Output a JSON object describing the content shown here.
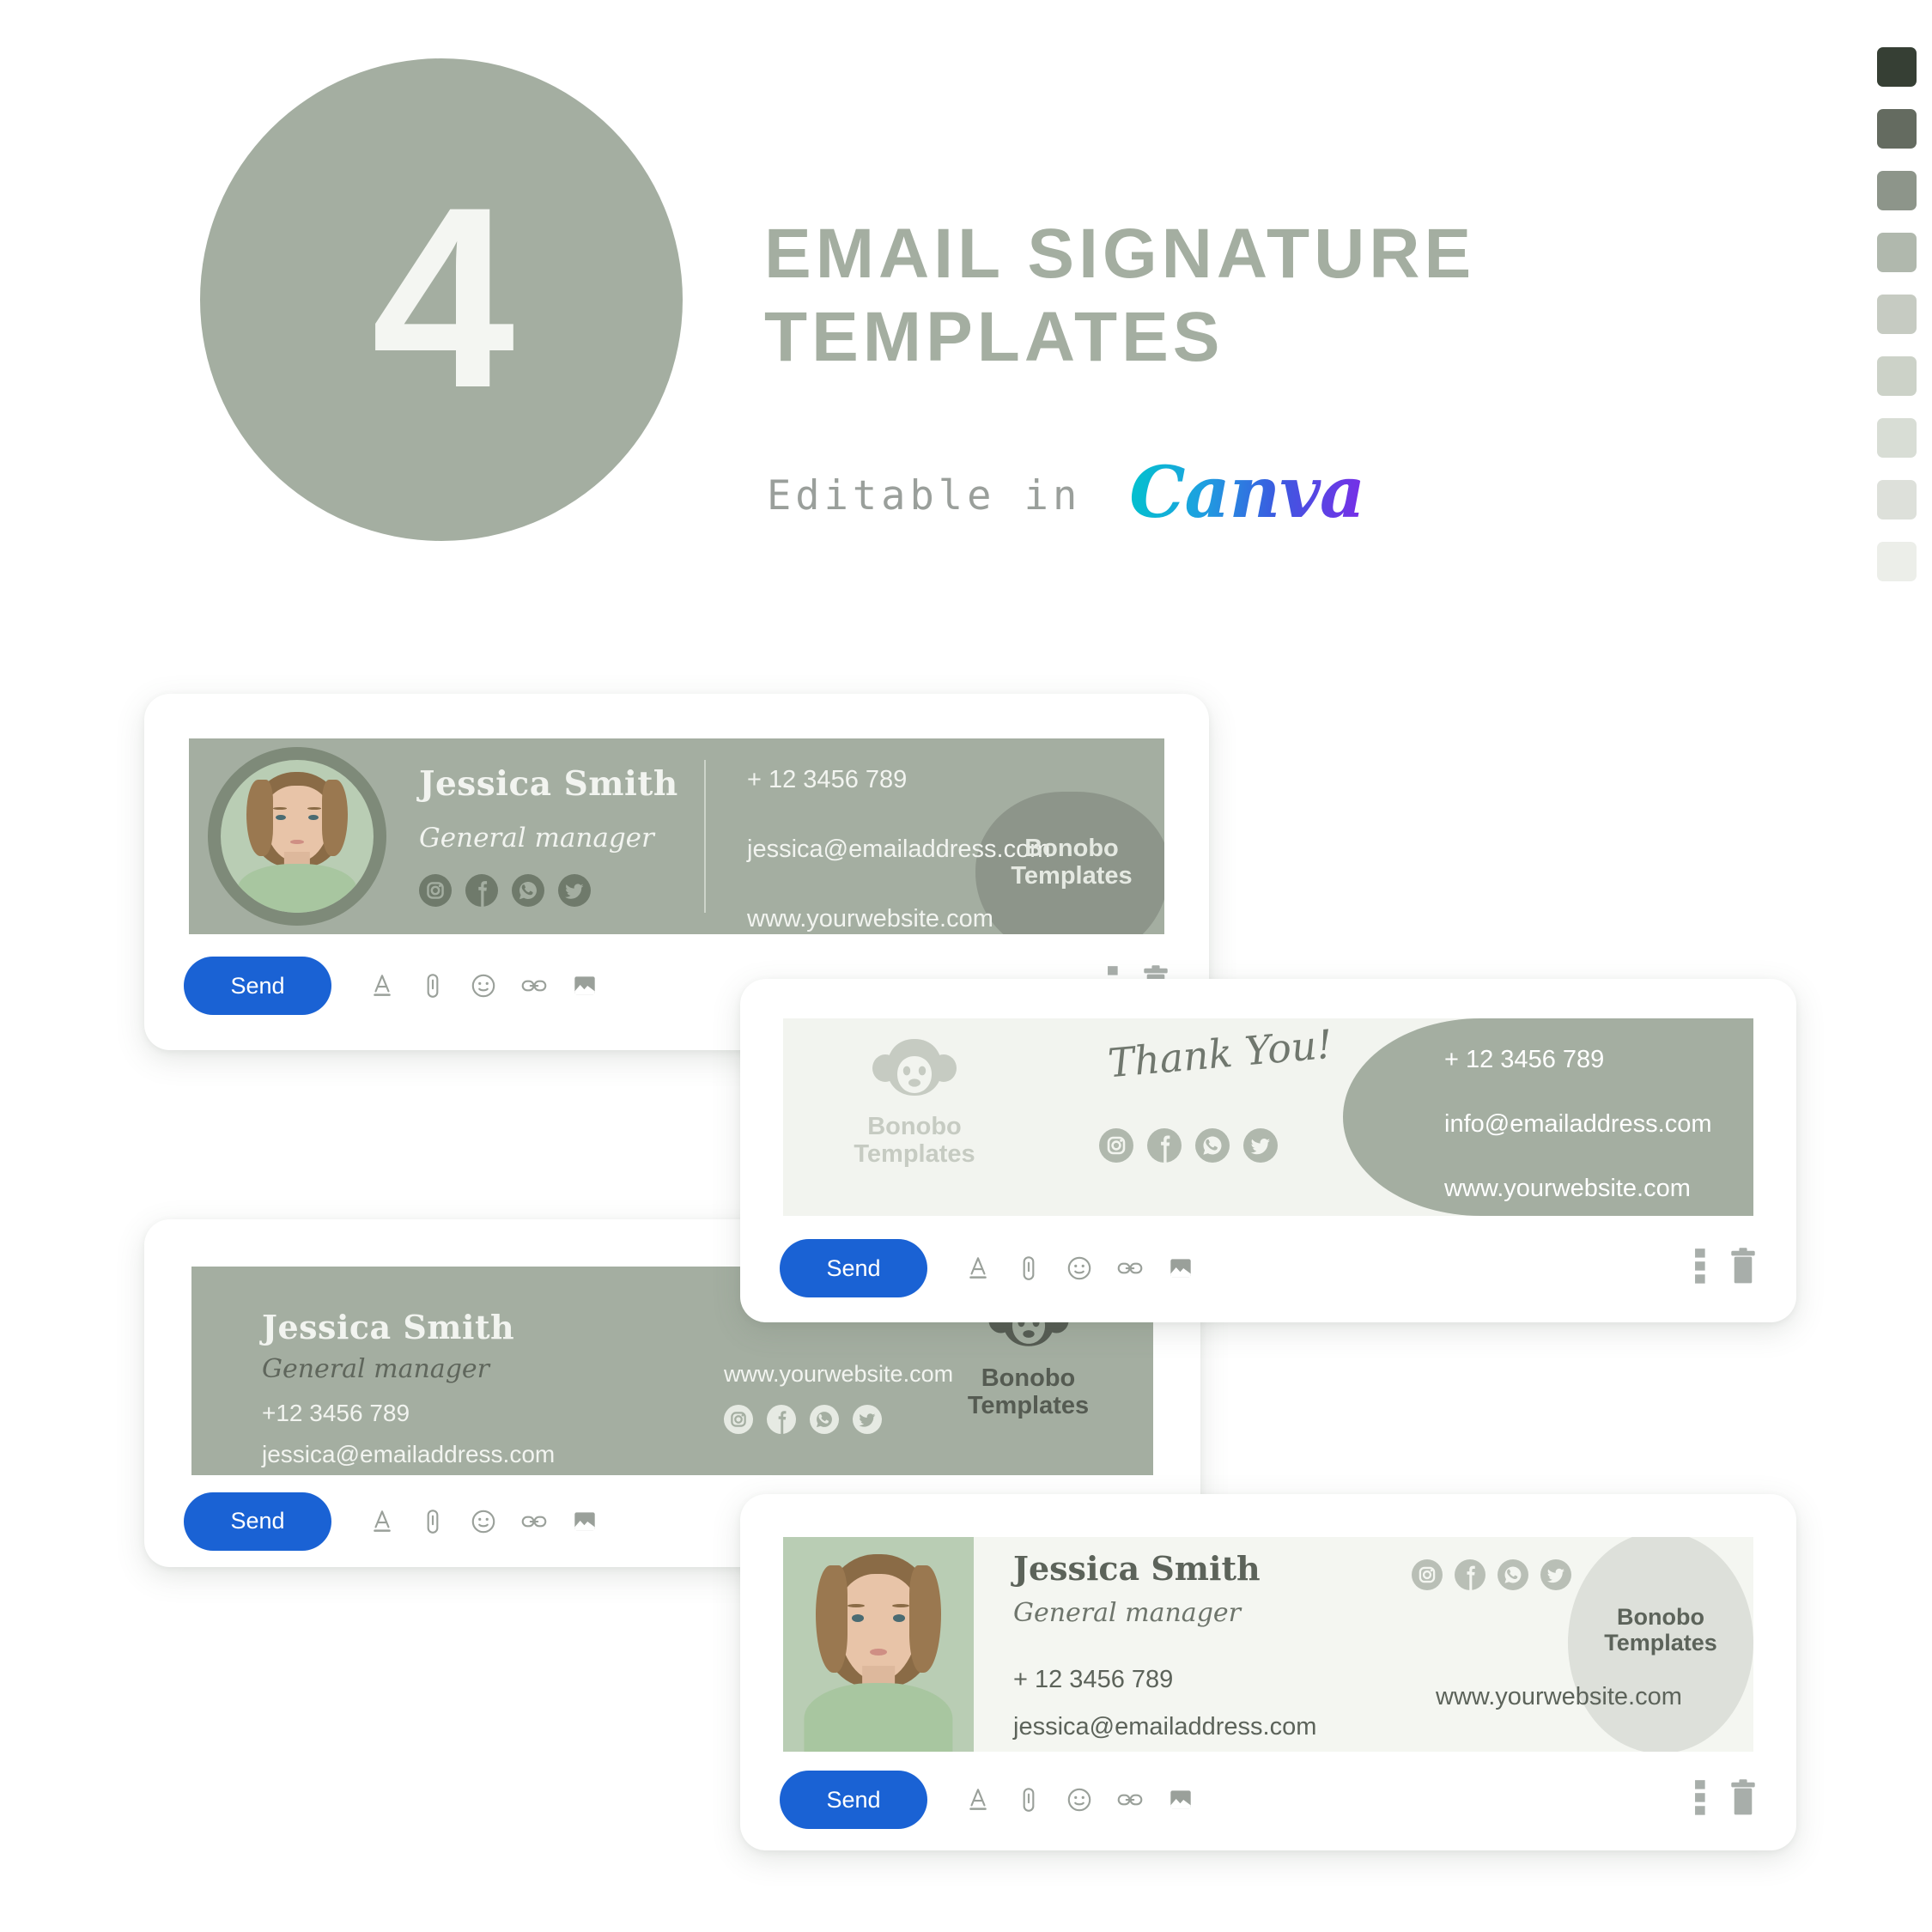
{
  "header": {
    "number": "4",
    "title_line1": "EMAIL SIGNATURE",
    "title_line2": "TEMPLATES",
    "editable_label": "Editable in",
    "brand": "Canva",
    "circle_color": "#a4aea1",
    "title_color": "#a4aea1"
  },
  "palette": {
    "label": "color-swatches",
    "swatches": [
      "#363f34",
      "#646b60",
      "#8d958a",
      "#b0b8ad",
      "#c6cbc2",
      "#ccd2c8",
      "#d8ddd5",
      "#dde0da",
      "#eceee9"
    ]
  },
  "toolbar": {
    "send_label": "Send",
    "icons": [
      "text-format-icon",
      "attachment-icon",
      "emoji-icon",
      "link-icon",
      "insert-image-icon"
    ],
    "more_icon": "more-options-icon",
    "delete_icon": "trash-icon",
    "send_color": "#1a62d4"
  },
  "social": {
    "items": [
      "instagram-icon",
      "facebook-icon",
      "whatsapp-icon",
      "twitter-icon"
    ]
  },
  "cards": [
    {
      "id": "template-1",
      "name": "Jessica Smith",
      "role": "General manager",
      "phone": "+ 12 3456 789",
      "email": "jessica@emailaddress.com",
      "website": "www.yourwebsite.com",
      "logo_line1": "Bonobo",
      "logo_line2": "Templates",
      "banner_color": "#a4aea1",
      "blob_color": "#8d958a",
      "text_color": "#f2f4f0"
    },
    {
      "id": "template-2",
      "greeting": "Thank You!",
      "phone": "+ 12 3456 789",
      "email": "info@emailaddress.com",
      "website": "www.yourwebsite.com",
      "logo_line1": "Bonobo",
      "logo_line2": "Templates",
      "banner_color": "#f2f4ef",
      "panel_color": "#a4aea1",
      "text_color": "#ffffff",
      "logo_color": "#c6cbc2"
    },
    {
      "id": "template-3",
      "name": "Jessica Smith",
      "role": "General manager",
      "phone": "+12 3456 789",
      "email": "jessica@emailaddress.com",
      "website": "www.yourwebsite.com",
      "logo_line1": "Bonobo",
      "logo_line2": "Templates",
      "banner_color": "#a4aea1",
      "text_color": "#f2f4f0",
      "logo_color": "#555b52"
    },
    {
      "id": "template-4",
      "name": "Jessica Smith",
      "role": "General manager",
      "phone": "+ 12 3456 789",
      "email": "jessica@emailaddress.com",
      "website": "www.yourwebsite.com",
      "logo_line1": "Bonobo",
      "logo_line2": "Templates",
      "banner_color": "#f4f6f1",
      "blob_color": "#dde0da",
      "text_color": "#5c635a"
    }
  ]
}
